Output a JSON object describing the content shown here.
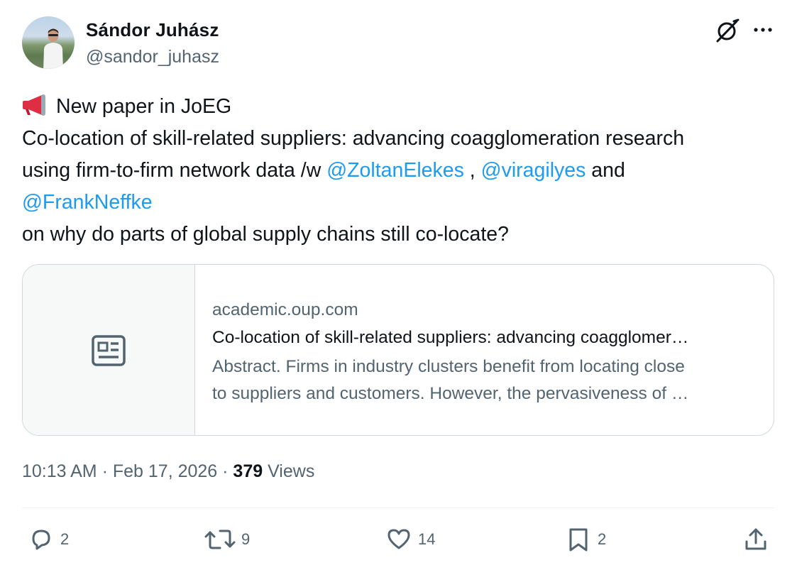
{
  "author": {
    "name": "Sándor Juhász",
    "handle": "@sandor_juhasz"
  },
  "tweet": {
    "line1_text": "New paper in JoEG",
    "line2_text": "Co-location of skill-related suppliers: advancing coagglomeration research",
    "line3_prefix": "using firm-to-firm network data /w ",
    "mention1": "@ZoltanElekes",
    "separator": " , ",
    "mention2": "@viragilyes",
    "and_text": " and",
    "mention3": "@FrankNeffke",
    "line5_text": "on why do parts of global supply chains still co-locate?",
    "emoji_icon": "megaphone-icon"
  },
  "card": {
    "domain": "academic.oup.com",
    "title": "Co-location of skill-related suppliers: advancing coagglomer…",
    "description_line1": "Abstract. Firms in industry clusters benefit from locating close",
    "description_line2": "to suppliers and customers. However, the pervasiveness of …",
    "thumb_icon": "article-icon"
  },
  "meta": {
    "time": "10:13 AM",
    "dot1": " · ",
    "date": "Feb 17, 2026",
    "dot2": " · ",
    "views_count": "379",
    "views_label": " Views"
  },
  "actions": {
    "reply_count": "2",
    "repost_count": "9",
    "like_count": "14",
    "bookmark_count": "2"
  },
  "colors": {
    "link": "#1d9bf0",
    "text": "#0f1419",
    "secondary": "#536471",
    "border": "#cfd9de"
  }
}
